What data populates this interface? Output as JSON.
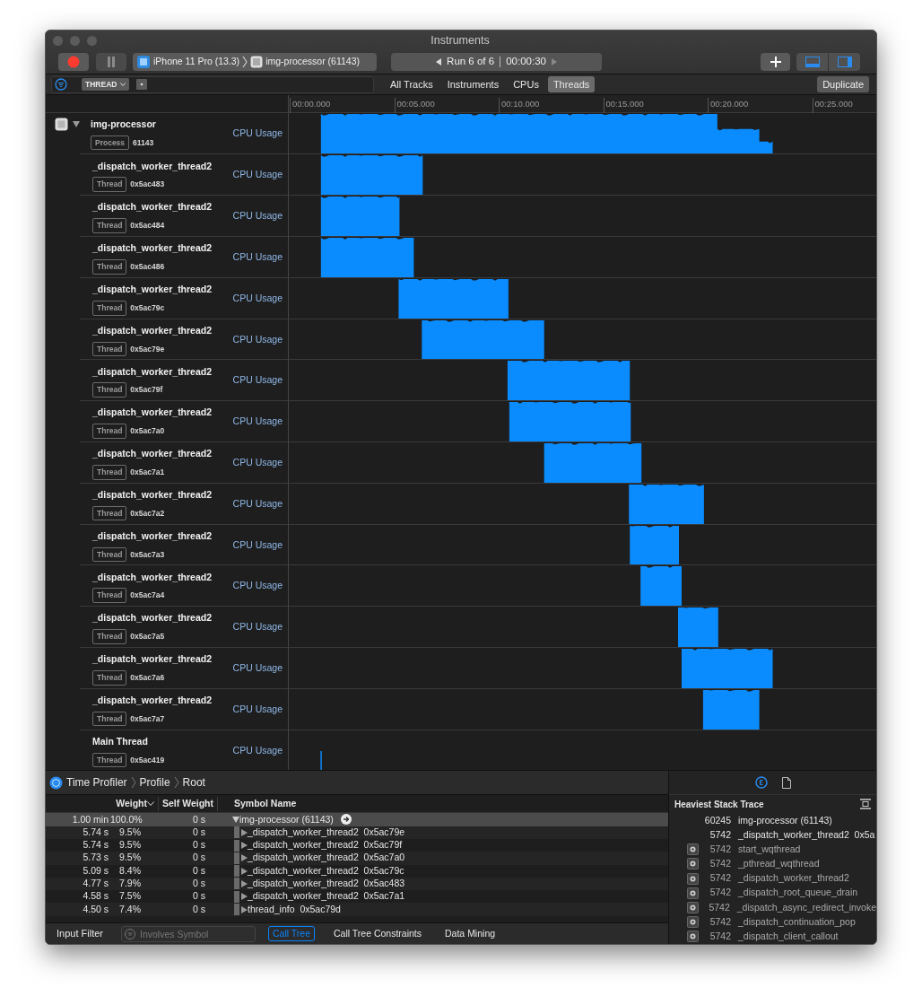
{
  "window": {
    "title": "Instruments"
  },
  "toolbar": {
    "device": "iPhone 11 Pro (13.3)",
    "target": "img-processor (61143)",
    "run": "Run 6 of 6",
    "elapsed": "00:00:30"
  },
  "filter_bar": {
    "token": "THREAD",
    "tabs": [
      {
        "label": "All Tracks",
        "selected": false
      },
      {
        "label": "Instruments",
        "selected": false
      },
      {
        "label": "CPUs",
        "selected": false
      },
      {
        "label": "Threads",
        "selected": true
      }
    ],
    "duplicate": "Duplicate"
  },
  "ruler": [
    "00:00.000",
    "00:05.000",
    "00:10.000",
    "00:15.000",
    "00:20.000",
    "00:25.000"
  ],
  "tracks": [
    {
      "kind": "process",
      "name": "img-processor",
      "badge": "Process",
      "id": "61143",
      "graph": "CPU Usage",
      "expanded": true
    },
    {
      "kind": "thread",
      "name": "_dispatch_worker_thread2",
      "badge": "Thread",
      "id": "0x5ac483",
      "graph": "CPU Usage"
    },
    {
      "kind": "thread",
      "name": "_dispatch_worker_thread2",
      "badge": "Thread",
      "id": "0x5ac484",
      "graph": "CPU Usage"
    },
    {
      "kind": "thread",
      "name": "_dispatch_worker_thread2",
      "badge": "Thread",
      "id": "0x5ac486",
      "graph": "CPU Usage"
    },
    {
      "kind": "thread",
      "name": "_dispatch_worker_thread2",
      "badge": "Thread",
      "id": "0x5ac79c",
      "graph": "CPU Usage"
    },
    {
      "kind": "thread",
      "name": "_dispatch_worker_thread2",
      "badge": "Thread",
      "id": "0x5ac79e",
      "graph": "CPU Usage"
    },
    {
      "kind": "thread",
      "name": "_dispatch_worker_thread2",
      "badge": "Thread",
      "id": "0x5ac79f",
      "graph": "CPU Usage"
    },
    {
      "kind": "thread",
      "name": "_dispatch_worker_thread2",
      "badge": "Thread",
      "id": "0x5ac7a0",
      "graph": "CPU Usage"
    },
    {
      "kind": "thread",
      "name": "_dispatch_worker_thread2",
      "badge": "Thread",
      "id": "0x5ac7a1",
      "graph": "CPU Usage"
    },
    {
      "kind": "thread",
      "name": "_dispatch_worker_thread2",
      "badge": "Thread",
      "id": "0x5ac7a2",
      "graph": "CPU Usage"
    },
    {
      "kind": "thread",
      "name": "_dispatch_worker_thread2",
      "badge": "Thread",
      "id": "0x5ac7a3",
      "graph": "CPU Usage"
    },
    {
      "kind": "thread",
      "name": "_dispatch_worker_thread2",
      "badge": "Thread",
      "id": "0x5ac7a4",
      "graph": "CPU Usage"
    },
    {
      "kind": "thread",
      "name": "_dispatch_worker_thread2",
      "badge": "Thread",
      "id": "0x5ac7a5",
      "graph": "CPU Usage"
    },
    {
      "kind": "thread",
      "name": "_dispatch_worker_thread2",
      "badge": "Thread",
      "id": "0x5ac7a6",
      "graph": "CPU Usage"
    },
    {
      "kind": "thread",
      "name": "_dispatch_worker_thread2",
      "badge": "Thread",
      "id": "0x5ac7a7",
      "graph": "CPU Usage"
    },
    {
      "kind": "thread",
      "name": "Main Thread",
      "badge": "Thread",
      "id": "0x5ac419",
      "graph": "CPU Usage"
    }
  ],
  "profiler": {
    "breadcrumbs": [
      "Time Profiler",
      "Profile",
      "Root"
    ],
    "columns": [
      "Weight",
      "Self Weight",
      "Symbol Name"
    ],
    "rows": [
      {
        "weight": "1.00 min",
        "percent": "100.0%",
        "self_weight": "0 s",
        "symbol": "img-processor (61143)",
        "expanded": true,
        "selected": true,
        "children": [
          {
            "weight": "5.74 s",
            "percent": "9.5%",
            "self_weight": "0 s",
            "symbol": "_dispatch_worker_thread2",
            "address": "0x5ac79e",
            "expanded": false,
            "selected": false
          },
          {
            "weight": "5.74 s",
            "percent": "9.5%",
            "self_weight": "0 s",
            "symbol": "_dispatch_worker_thread2",
            "address": "0x5ac79f",
            "expanded": false,
            "selected": false
          },
          {
            "weight": "5.73 s",
            "percent": "9.5%",
            "self_weight": "0 s",
            "symbol": "_dispatch_worker_thread2",
            "address": "0x5ac7a0",
            "expanded": false,
            "selected": false
          },
          {
            "weight": "5.09 s",
            "percent": "8.4%",
            "self_weight": "0 s",
            "symbol": "_dispatch_worker_thread2",
            "address": "0x5ac79c",
            "expanded": false,
            "selected": false
          },
          {
            "weight": "4.77 s",
            "percent": "7.9%",
            "self_weight": "0 s",
            "symbol": "_dispatch_worker_thread2",
            "address": "0x5ac483",
            "expanded": false,
            "selected": false
          },
          {
            "weight": "4.58 s",
            "percent": "7.5%",
            "self_weight": "0 s",
            "symbol": "_dispatch_worker_thread2",
            "address": "0x5ac7a1",
            "expanded": false,
            "selected": false
          },
          {
            "weight": "4.50 s",
            "percent": "7.4%",
            "self_weight": "0 s",
            "symbol": "thread_info",
            "address": "0x5ac79d",
            "expanded": false,
            "selected": false
          }
        ]
      }
    ]
  },
  "bottom_bar": {
    "label": "Input Filter",
    "search": {
      "placeholder": "Involves Symbol"
    },
    "tabs": [
      {
        "label": "Call Tree",
        "selected": true
      },
      {
        "label": "Call Tree Constraints",
        "selected": false
      },
      {
        "label": "Data Mining",
        "selected": false
      }
    ]
  },
  "inspector": {
    "title": "Heaviest Stack Trace",
    "frames": [
      {
        "kind": "user",
        "count": "60245",
        "symbol": "img-processor (61143)"
      },
      {
        "kind": "user",
        "count": "5742",
        "symbol": "_dispatch_worker_thread2",
        "address": "0x5a"
      },
      {
        "kind": "system",
        "count": "5742",
        "symbol": "start_wqthread"
      },
      {
        "kind": "system",
        "count": "5742",
        "symbol": "_pthread_wqthread"
      },
      {
        "kind": "system",
        "count": "5742",
        "symbol": "_dispatch_worker_thread2"
      },
      {
        "kind": "system",
        "count": "5742",
        "symbol": "_dispatch_root_queue_drain"
      },
      {
        "kind": "system",
        "count": "5742",
        "symbol": "_dispatch_async_redirect_invoke"
      },
      {
        "kind": "system",
        "count": "5742",
        "symbol": "_dispatch_continuation_pop"
      },
      {
        "kind": "system",
        "count": "5742",
        "symbol": "_dispatch_client_callout"
      }
    ]
  }
}
